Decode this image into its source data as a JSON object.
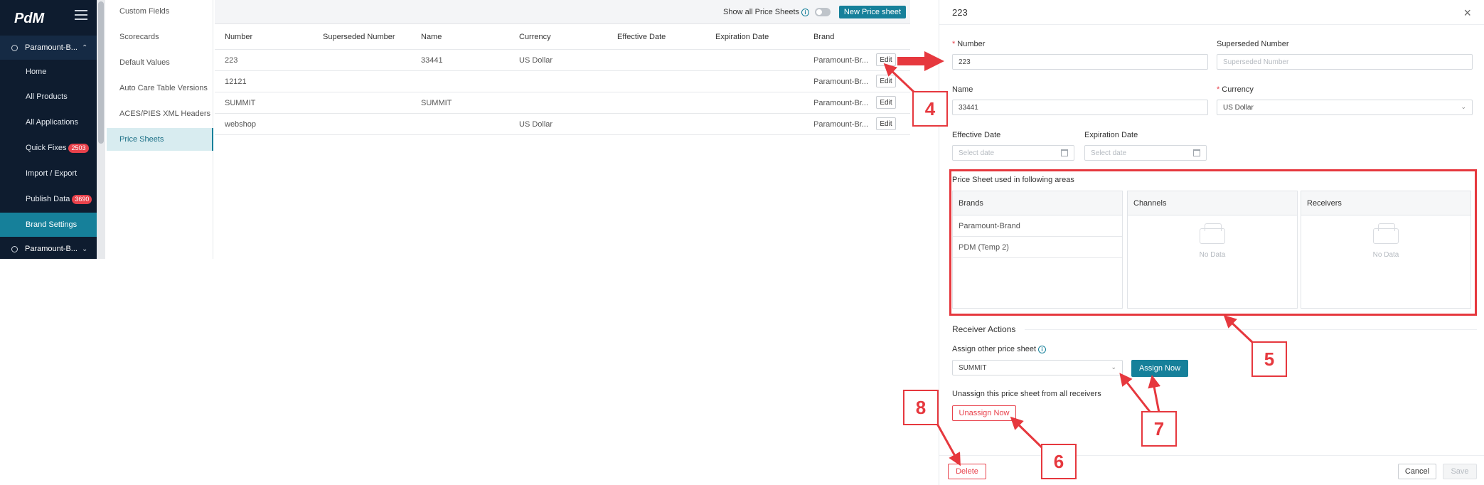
{
  "sidebar": {
    "logo_text": "PdM",
    "workspace_label": "Paramount-B...",
    "items": [
      {
        "label": "Home"
      },
      {
        "label": "All Products"
      },
      {
        "label": "All Applications"
      },
      {
        "label": "Quick Fixes",
        "badge": "2503"
      },
      {
        "label": "Import / Export"
      },
      {
        "label": "Publish Data",
        "badge": "3690"
      },
      {
        "label": "Brand Settings"
      }
    ],
    "workspace2_label": "Paramount-B..."
  },
  "submenu": {
    "items": [
      {
        "label": "Custom Fields"
      },
      {
        "label": "Scorecards"
      },
      {
        "label": "Default Values"
      },
      {
        "label": "Auto Care Table Versions"
      },
      {
        "label": "ACES/PIES XML Headers"
      },
      {
        "label": "Price Sheets"
      }
    ]
  },
  "toolbar": {
    "show_all_label": "Show all Price Sheets",
    "new_button": "New Price sheet"
  },
  "table": {
    "columns": [
      "Number",
      "Superseded Number",
      "Name",
      "Currency",
      "Effective Date",
      "Expiration Date",
      "Brand"
    ],
    "edit_label": "Edit",
    "rows": [
      {
        "number": "223",
        "superseded": "",
        "name": "33441",
        "currency": "US Dollar",
        "effective": "",
        "expiration": "",
        "brand": "Paramount-Br..."
      },
      {
        "number": "12121",
        "superseded": "",
        "name": "",
        "currency": "",
        "effective": "",
        "expiration": "",
        "brand": "Paramount-Br..."
      },
      {
        "number": "SUMMIT",
        "superseded": "",
        "name": "SUMMIT",
        "currency": "",
        "effective": "",
        "expiration": "",
        "brand": "Paramount-Br..."
      },
      {
        "number": "webshop",
        "superseded": "",
        "name": "",
        "currency": "US Dollar",
        "effective": "",
        "expiration": "",
        "brand": "Paramount-Br..."
      }
    ]
  },
  "panel": {
    "title": "223",
    "number_label": "Number",
    "number_value": "223",
    "superseded_label": "Superseded Number",
    "superseded_placeholder": "Superseded Number",
    "name_label": "Name",
    "name_value": "33441",
    "currency_label": "Currency",
    "currency_value": "US Dollar",
    "effective_label": "Effective Date",
    "effective_placeholder": "Select date",
    "expiration_label": "Expiration Date",
    "expiration_placeholder": "Select date",
    "usage_title": "Price Sheet used in following areas",
    "brands_header": "Brands",
    "brands": [
      "Paramount-Brand",
      "PDM (Temp 2)"
    ],
    "channels_header": "Channels",
    "receivers_header": "Receivers",
    "no_data": "No Data",
    "receiver_actions_title": "Receiver Actions",
    "assign_label": "Assign other price sheet",
    "assign_value": "SUMMIT",
    "assign_button": "Assign Now",
    "unassign_label": "Unassign this price sheet from all receivers",
    "unassign_button": "Unassign Now",
    "delete_button": "Delete",
    "cancel_button": "Cancel",
    "save_button": "Save"
  },
  "annotations": {
    "callouts": [
      "4",
      "5",
      "6",
      "7",
      "8"
    ],
    "color": "#e6383e"
  },
  "colors": {
    "accent": "#16809a",
    "sidebar_bg": "#0e1c2f",
    "danger": "#e8414b"
  }
}
